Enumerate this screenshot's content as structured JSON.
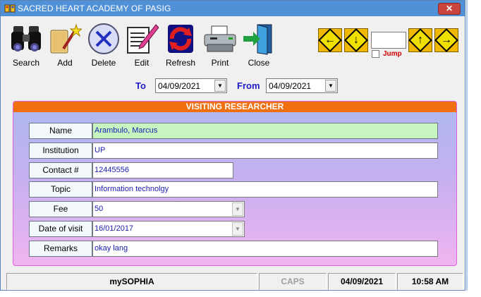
{
  "window": {
    "title": "SACRED HEART ACADEMY OF PASIG",
    "close_label": "✕"
  },
  "toolbar": [
    {
      "label": "Search",
      "icon": "binoculars-icon"
    },
    {
      "label": "Add",
      "icon": "add-wand-icon"
    },
    {
      "label": "Delete",
      "icon": "delete-x-icon"
    },
    {
      "label": "Edit",
      "icon": "edit-pencil-icon"
    },
    {
      "label": "Refresh",
      "icon": "refresh-icon"
    },
    {
      "label": "Print",
      "icon": "printer-icon"
    },
    {
      "label": "Close",
      "icon": "exit-door-icon"
    }
  ],
  "navigation": {
    "first_arrow": "←",
    "prev_arrow": "↓",
    "next_arrow": "↑",
    "last_arrow": "→",
    "jump_value": "",
    "jump_label": "Jump",
    "jump_checked": false
  },
  "date_range": {
    "to_label": "To",
    "to_value": "04/09/2021",
    "from_label": "From",
    "from_value": "04/09/2021"
  },
  "panel": {
    "title": "VISITING RESEARCHER",
    "fields": {
      "name": {
        "label": "Name",
        "value": "Arambulo, Marcus"
      },
      "institution": {
        "label": "Institution",
        "value": "UP"
      },
      "contact": {
        "label": "Contact #",
        "value": "12445556"
      },
      "topic": {
        "label": "Topic",
        "value": "Information technolgy"
      },
      "fee": {
        "label": "Fee",
        "value": "50"
      },
      "date_of_visit": {
        "label": "Date of visit",
        "value": "16/01/2017"
      },
      "remarks": {
        "label": "Remarks",
        "value": "okay lang"
      }
    }
  },
  "statusbar": {
    "app": "mySOPHIA",
    "caps": "CAPS",
    "date": "04/09/2021",
    "time": "10:58 AM"
  },
  "colors": {
    "titlebar": "#4f90d6",
    "panel_header": "#f07010",
    "highlight_field": "#c6f5c0",
    "label_blue": "#1a1ac8"
  }
}
